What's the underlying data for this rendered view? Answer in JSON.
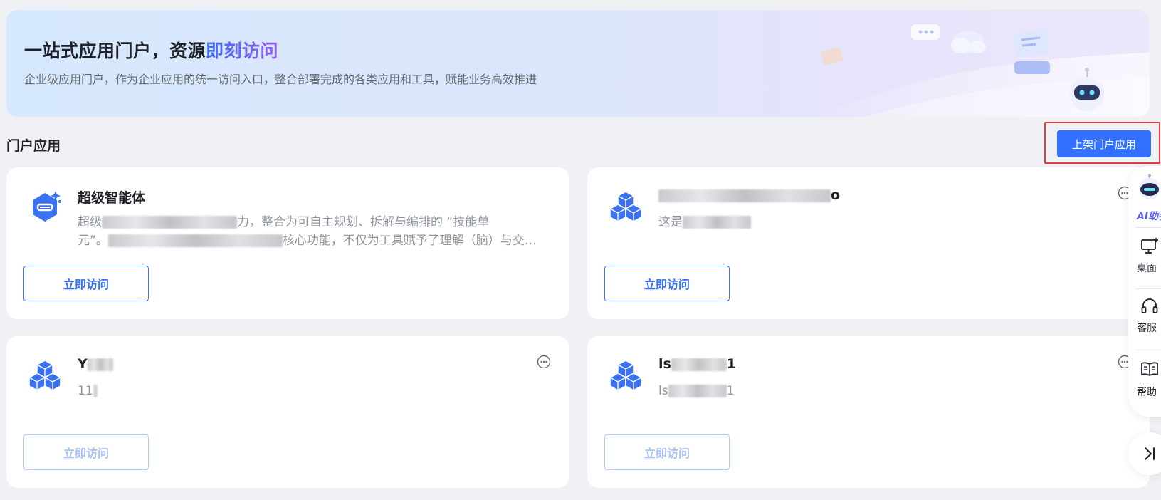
{
  "banner": {
    "title_main": "一站式应用门户，资源",
    "title_highlight": "即刻访问",
    "subtitle": "企业级应用门户，作为企业应用的统一访问入口，整合部署完成的各类应用和工具，赋能业务高效推进"
  },
  "section": {
    "title": "门户应用",
    "publish_label": "上架门户应用"
  },
  "cards": [
    {
      "name": "超级智能体",
      "desc_a": "超级",
      "desc_b": "力，整合为可自主规划、拆解与编排的 “技能单",
      "desc_c": "元”。",
      "desc_d": "核心功能，不仅为工具赋予了理解（脑）与交互…",
      "visit_label": "立即访问"
    },
    {
      "name_suffix": "o",
      "desc_prefix": "这是",
      "visit_label": "立即访问"
    },
    {
      "name_prefix": "Y",
      "desc_prefix": "11",
      "visit_label": "立即访问"
    },
    {
      "name_prefix": "ls",
      "name_suffix": "1",
      "desc_prefix": "ls",
      "desc_suffix": "1",
      "visit_label": "立即访问"
    }
  ],
  "float_panel": {
    "ai_label": "AI助手",
    "items": [
      {
        "label": "桌面"
      },
      {
        "label": "客服"
      },
      {
        "label": "帮助"
      }
    ]
  },
  "colors": {
    "primary": "#3370ff",
    "highlight_border": "#e03c3c"
  }
}
